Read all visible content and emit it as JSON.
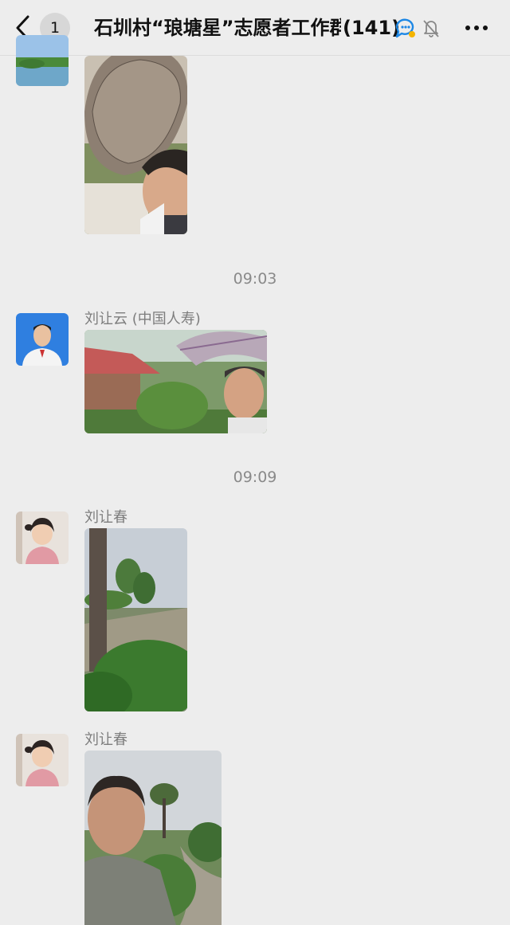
{
  "header": {
    "back_count": "1",
    "title": "石圳村“琅塘星”志愿者工作群",
    "member_count": "(141)"
  },
  "messages": [
    {
      "time": "09:03",
      "sender": "刘让云 (中国人寿)"
    },
    {
      "time": "09:09",
      "sender": "刘让春"
    },
    {
      "sender": "刘让春"
    }
  ],
  "colors": {
    "background": "#ededed",
    "accent": "#1e88e5"
  },
  "icons": [
    "back-chevron-icon",
    "chat-bubble-icon",
    "bell-muted-icon",
    "more-dots-icon"
  ]
}
